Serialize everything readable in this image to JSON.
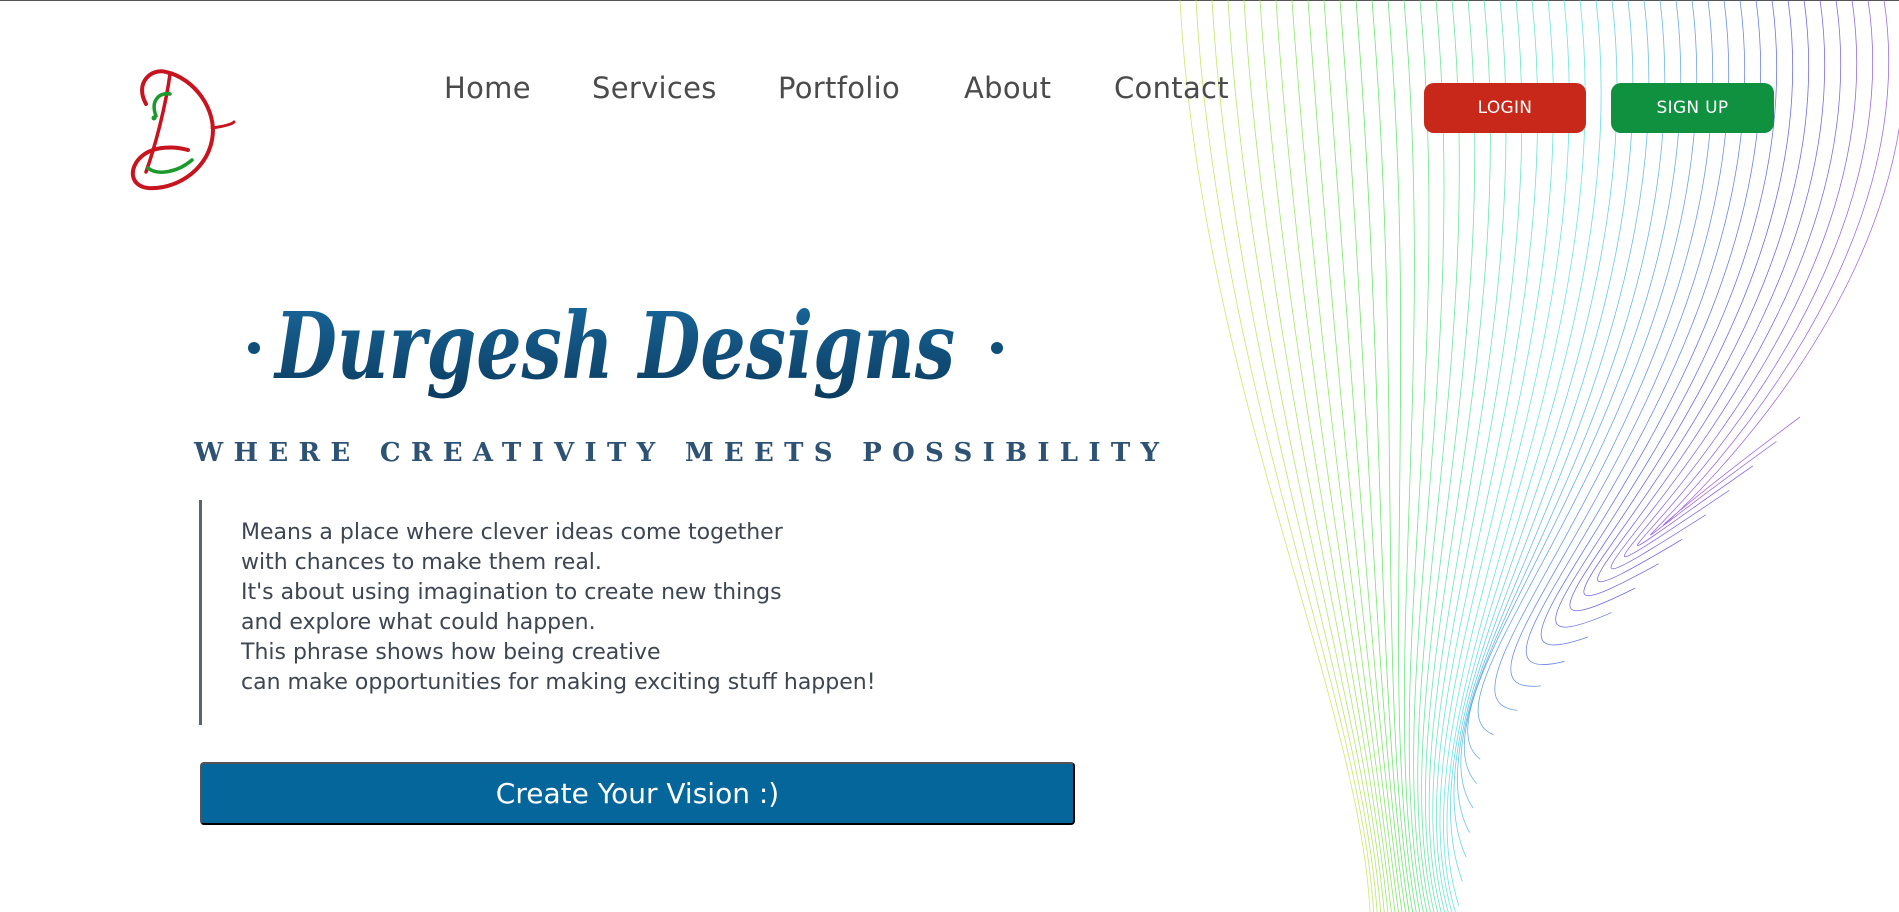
{
  "brand": {
    "logo_icon": "script-d-logo-icon",
    "title": "Durgesh Designs",
    "tagline": "WHERE CREATIVITY MEETS POSSIBILITY",
    "colors": {
      "title_blue": "#0f4f7a",
      "tagline_blue": "#2e5274",
      "logo_red": "#c8141e",
      "logo_green": "#1a9a2a"
    }
  },
  "nav": {
    "items": [
      {
        "label": "Home"
      },
      {
        "label": "Services"
      },
      {
        "label": "Portfolio"
      },
      {
        "label": "About"
      },
      {
        "label": "Contact"
      }
    ]
  },
  "auth": {
    "login_label": "LOGIN",
    "signup_label": "SIGN UP",
    "login_color": "#c8281a",
    "signup_color": "#0f9140"
  },
  "hero": {
    "description_lines": [
      "Means a place where clever ideas come together",
      "with chances to make them real.",
      "It's about using imagination to create new things",
      "and explore what could happen.",
      "This phrase shows how being creative",
      "can make opportunities for making exciting stuff happen!"
    ],
    "cta_label": "Create Your Vision :)",
    "cta_color": "#05669b"
  }
}
